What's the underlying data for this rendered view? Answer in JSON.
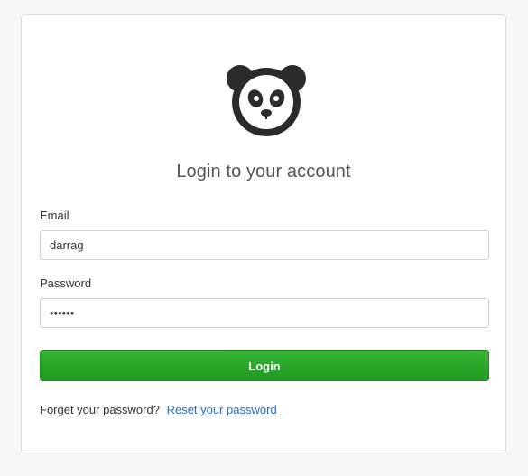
{
  "login": {
    "logo_icon": "panda-icon",
    "title": "Login to your account",
    "email_label": "Email",
    "email_value": "darrag",
    "password_label": "Password",
    "password_value": "abcdef",
    "login_button": "Login",
    "forgot_text": "Forget your password?",
    "reset_link": "Reset your password"
  },
  "colors": {
    "background": "#f7f7f7",
    "card": "#ffffff",
    "button_green": "#28a428",
    "link_blue": "#2a6ebb"
  }
}
